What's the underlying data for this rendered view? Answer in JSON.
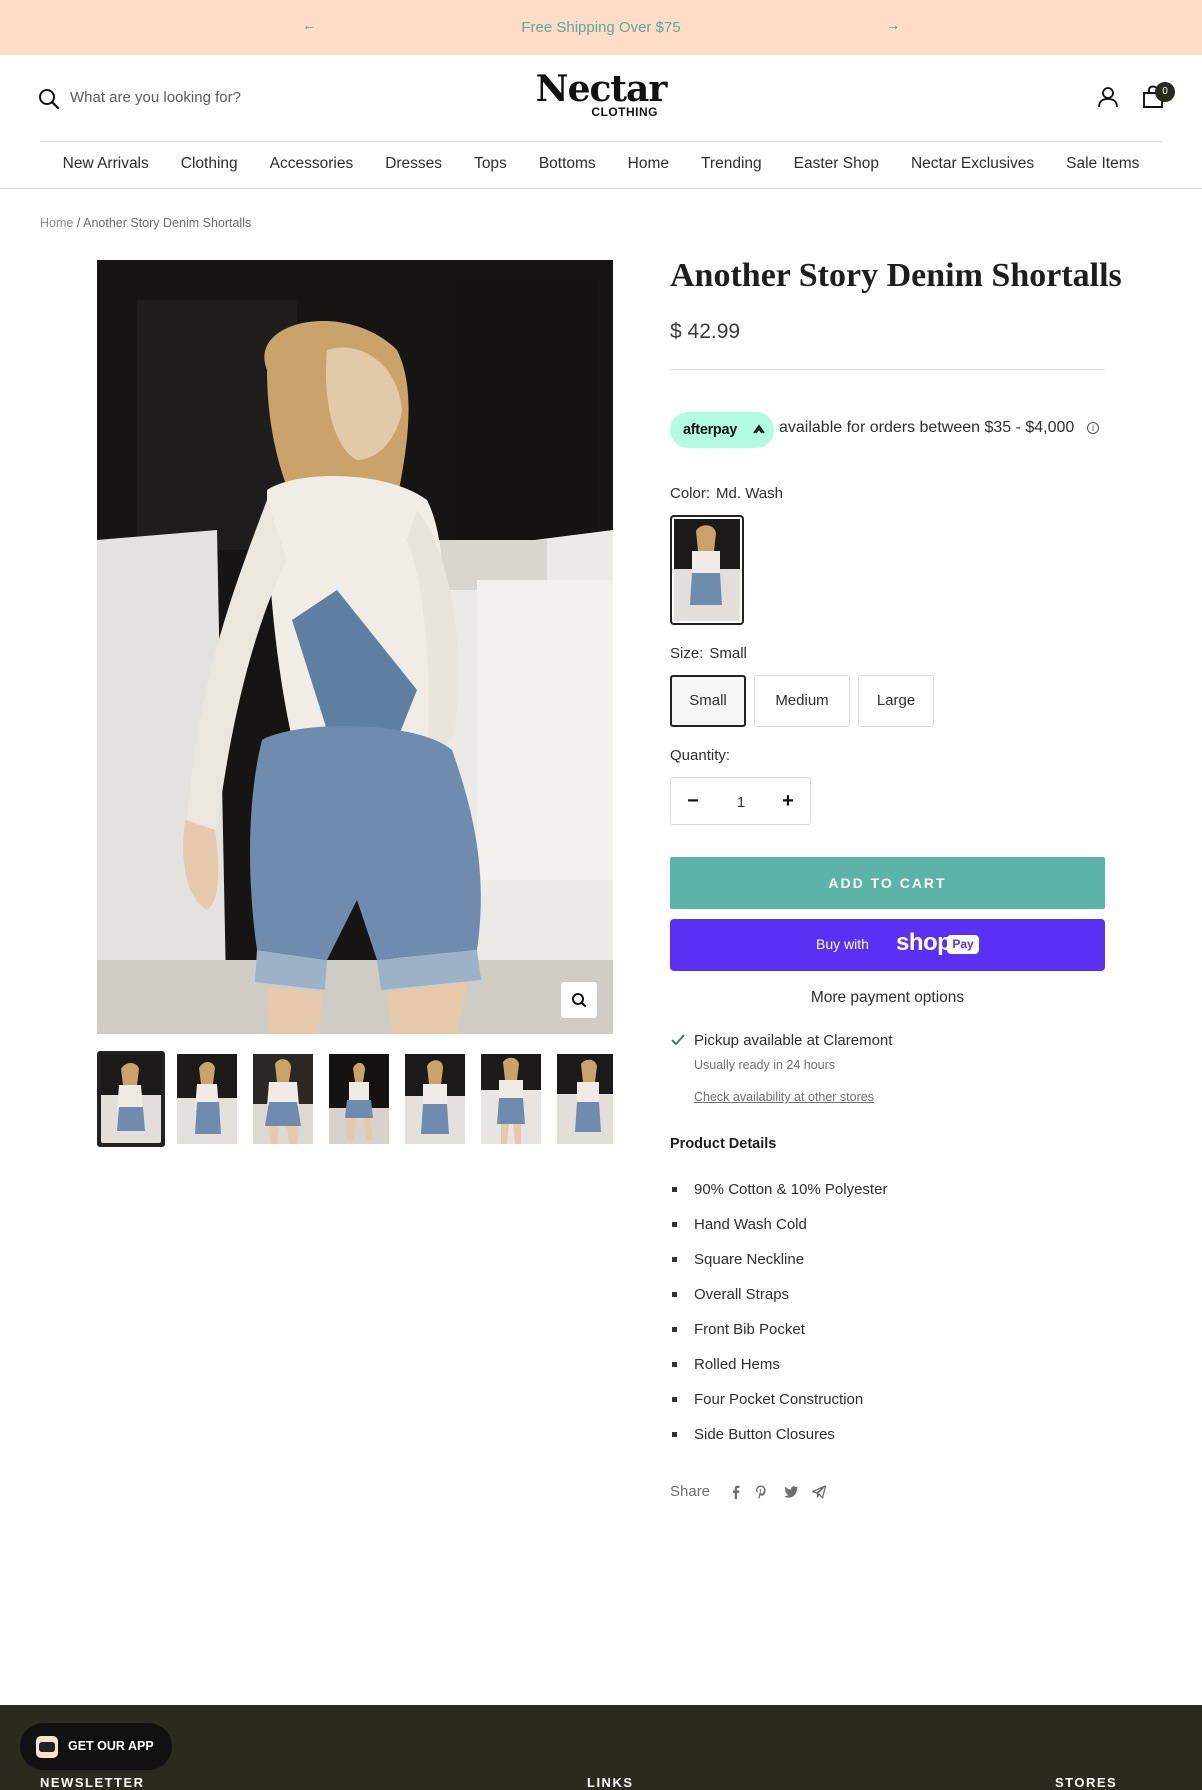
{
  "announcement": {
    "text": "Free Shipping Over $75",
    "prev_icon": "arrow-left-icon",
    "next_icon": "arrow-right-icon"
  },
  "header": {
    "search_placeholder": "What are you looking for?",
    "logo_main": "Nectar",
    "logo_sub": "CLOTHING",
    "cart_count": "0"
  },
  "nav": {
    "items": [
      "New Arrivals",
      "Clothing",
      "Accessories",
      "Dresses",
      "Tops",
      "Bottoms",
      "Home",
      "Trending",
      "Easter Shop",
      "Nectar Exclusives",
      "Sale Items"
    ]
  },
  "breadcrumb": {
    "home": "Home",
    "separator": "/",
    "current": "Another Story Denim Shortalls"
  },
  "product": {
    "title": "Another Story Denim Shortalls",
    "price": "$ 42.99",
    "afterpay_logo": "afterpay",
    "afterpay_text": "available for orders between $35 - $4,000",
    "color_label": "Color:",
    "color_value": "Md. Wash",
    "size_label": "Size:",
    "size_value": "Small",
    "sizes": [
      "Small",
      "Medium",
      "Large"
    ],
    "quantity_label": "Quantity:",
    "quantity": "1",
    "add_to_cart": "ADD TO CART",
    "buy_with": "Buy with",
    "shop_word": "shop",
    "pay_word": "Pay",
    "more_payment": "More payment options"
  },
  "pickup": {
    "title": "Pickup available at Claremont",
    "subtitle": "Usually ready in 24 hours",
    "link": "Check availability at other stores"
  },
  "details": {
    "heading": "Product Details",
    "items": [
      "90% Cotton & 10% Polyester",
      "Hand Wash Cold",
      "Square Neckline",
      "Overall Straps",
      "Front Bib Pocket",
      "Rolled Hems",
      "Four Pocket Construction",
      "Side Button Closures"
    ]
  },
  "share": {
    "label": "Share",
    "icons": [
      "facebook-icon",
      "pinterest-icon",
      "twitter-icon",
      "email-share-icon"
    ]
  },
  "footer": {
    "newsletter": "NEWSLETTER",
    "links": "LINKS",
    "stores": "STORES"
  },
  "app_button": {
    "label": "GET OUR APP"
  },
  "colors": {
    "announcement_bg": "#fddcc8",
    "accent_teal": "#5cb3a8",
    "shop_pay": "#5a31f4",
    "afterpay_mint": "#b2fce4",
    "footer_bg": "#2b2a1e"
  }
}
